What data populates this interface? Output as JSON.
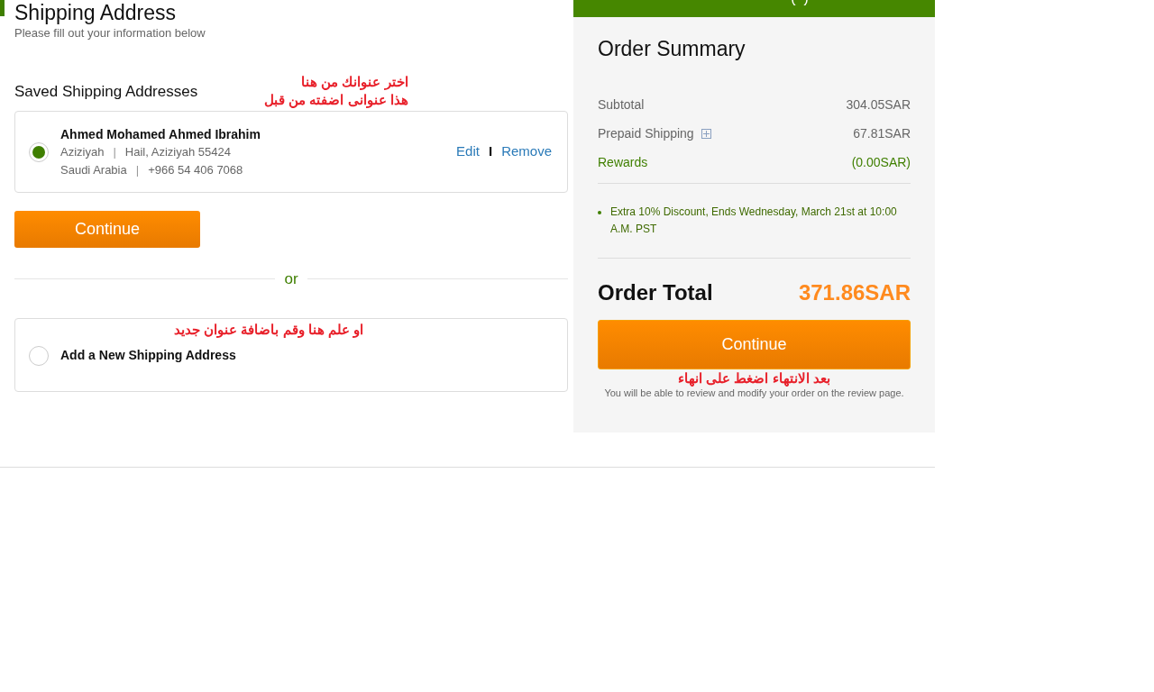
{
  "shipping": {
    "title": "Shipping Address",
    "subtitle": "Please fill out your information below",
    "saved_heading": "Saved Shipping Addresses",
    "annotation_saved": [
      "اختر عنوانك من هنا",
      "هذا عنوانى اضفته من قبل"
    ],
    "saved_address": {
      "selected": true,
      "name": "Ahmed Mohamed Ahmed Ibrahim",
      "line1": [
        "Aziziyah",
        "Hail, Aziziyah 55424"
      ],
      "line2": [
        "Saudi Arabia",
        "+966 54 406 7068"
      ],
      "separator": "|",
      "edit": "Edit",
      "link_separator": "I",
      "remove": "Remove"
    },
    "continue": "Continue",
    "or": "or",
    "annotation_new": "او علم هنا وقم باضافة عنوان جديد",
    "new_address": {
      "selected": false,
      "label": "Add a New Shipping Address"
    }
  },
  "summary": {
    "title": "Order Summary",
    "rows": [
      {
        "kind": "plain",
        "label": "Subtotal",
        "value": "304.05SAR"
      },
      {
        "kind": "expandable",
        "label": "Prepaid Shipping",
        "value": "67.81SAR"
      },
      {
        "kind": "reward",
        "label": "Rewards",
        "value": "(0.00SAR)"
      }
    ],
    "promotions": [
      "Extra 10% Discount, Ends Wednesday, March 21st at 10:00 A.M. PST"
    ],
    "total_label": "Order Total",
    "total_value": "371.86SAR",
    "continue": "Continue",
    "annotation_continue": "بعد الانتهاء اضغط على انهاء",
    "note": "You will be able to review and modify your order on the review page."
  }
}
